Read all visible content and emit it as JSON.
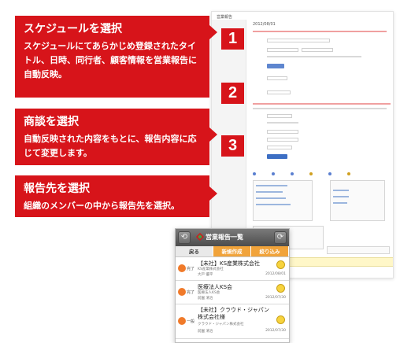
{
  "callouts": [
    {
      "title": "スケジュールを選択",
      "body": "スケジュールにてあらかじめ登録されたタイトル、日時、同行者、顧客情報を営業報告に自動反映。"
    },
    {
      "title": "商談を選択",
      "body": "自動反映された内容をもとに、報告内容に応じて変更します。"
    },
    {
      "title": "報告先を選択",
      "body": "組織のメンバーの中から報告先を選択。"
    }
  ],
  "steps": [
    "1",
    "2",
    "3"
  ],
  "screenshot": {
    "title": "営業報告",
    "date": "2012/08/01"
  },
  "phone": {
    "title": "営業報告一覧",
    "tabs": [
      "戻る",
      "新規作成",
      "絞り込み"
    ],
    "items": [
      {
        "status": "完了",
        "name": "【未社】KS産業株式会社",
        "sub": "KS産業株式会社",
        "person": "大戸 優平",
        "date": "2012/08/01"
      },
      {
        "status": "完了",
        "name": "医療法人KS会",
        "sub": "医療法人KS会",
        "person": "前園 清治",
        "date": "2012/07/30"
      },
      {
        "status": "一般",
        "name": "【未社】クラウド・ジャパン株式会社様",
        "sub": "クラウド・ジャパン株式会社",
        "person": "前園 清治",
        "date": "2012/07/30"
      }
    ]
  },
  "colors": {
    "accent": "#d7141a",
    "orange": "#f1a33a",
    "status_circle": "#f07a2a"
  }
}
